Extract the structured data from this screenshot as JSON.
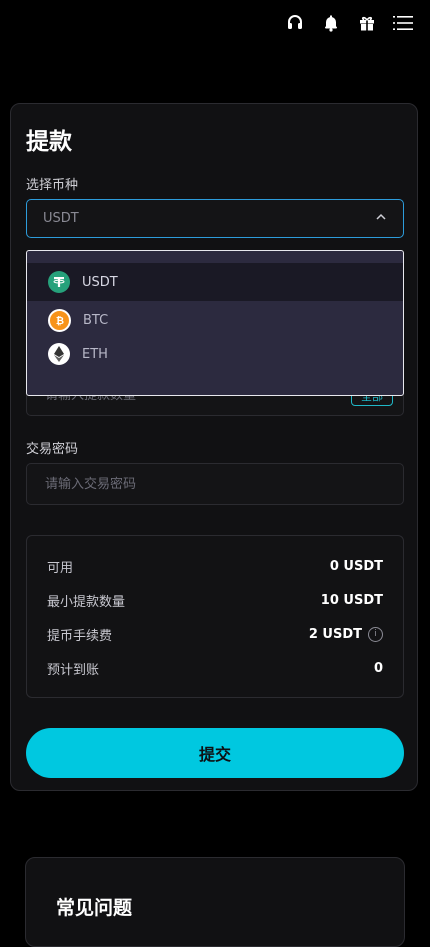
{
  "topbar": {
    "icons": [
      "headset-icon",
      "bell-icon",
      "gift-icon",
      "menu-icon"
    ]
  },
  "withdraw": {
    "title": "提款",
    "currency_label": "选择币种",
    "selected_currency": "USDT",
    "amount_placeholder": "请输入提款数量",
    "all_button": "全部",
    "password_label": "交易密码",
    "password_placeholder": "请输入交易密码",
    "info": [
      {
        "label": "可用",
        "value": "0 USDT"
      },
      {
        "label": "最小提款数量",
        "value": "10 USDT"
      },
      {
        "label": "提币手续费",
        "value": "2 USDT"
      },
      {
        "label": "预计到账",
        "value": "0"
      }
    ],
    "fee_info_icon": "i",
    "submit_label": "提交"
  },
  "dropdown": {
    "options": [
      {
        "label": "USDT",
        "icon": "tether-icon",
        "selected": true,
        "color": "#26a17b"
      },
      {
        "label": "BTC",
        "icon": "bitcoin-icon",
        "selected": false,
        "color": "#f7931a"
      },
      {
        "label": "ETH",
        "icon": "ethereum-icon",
        "selected": false,
        "color": "#ffffff"
      }
    ]
  },
  "faq": {
    "title": "常见问题"
  },
  "colors": {
    "accent": "#00c8e0",
    "focus_border": "#2d9cdb"
  }
}
